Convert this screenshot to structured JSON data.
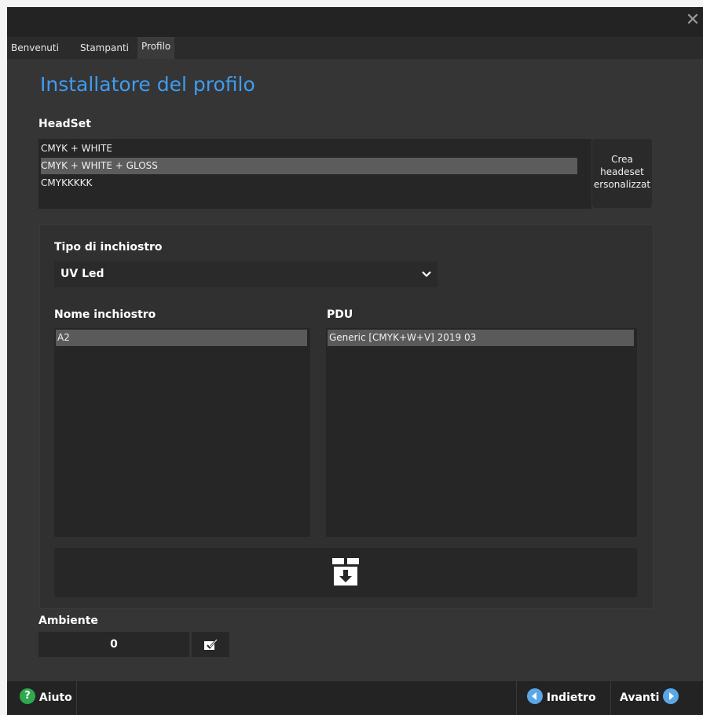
{
  "window": {
    "close_icon": "close-icon"
  },
  "tabs": [
    {
      "label": "Benvenuti"
    },
    {
      "label": "Stampanti"
    },
    {
      "label": "Profilo"
    }
  ],
  "page_title": "Installatore del profilo",
  "headset": {
    "label": "HeadSet",
    "items": [
      "CMYK + WHITE",
      "CMYK + WHITE + GLOSS",
      "CMYKKKKK"
    ],
    "selected_index": 1,
    "create_button": {
      "line1": "Crea",
      "line2": "headeset",
      "line3": "ersonalizzat"
    }
  },
  "ink_type": {
    "label": "Tipo di inchiostro",
    "value": "UV Led"
  },
  "ink_name": {
    "label": "Nome inchiostro",
    "items": [
      "A2"
    ]
  },
  "pdu": {
    "label": "PDU",
    "items": [
      "Generic [CMYK+W+V] 2019 03"
    ]
  },
  "install_button": {
    "icon": "box-download-icon"
  },
  "ambiente": {
    "label": "Ambiente",
    "value": "0",
    "edit_icon": "edit-icon"
  },
  "footer": {
    "help_label": "Aiuto",
    "back_label": "Indietro",
    "next_label": "Avanti"
  },
  "colors": {
    "accent_title": "#3f9cf0",
    "help_green": "#2fa84f",
    "nav_blue": "#5aa7e8"
  }
}
